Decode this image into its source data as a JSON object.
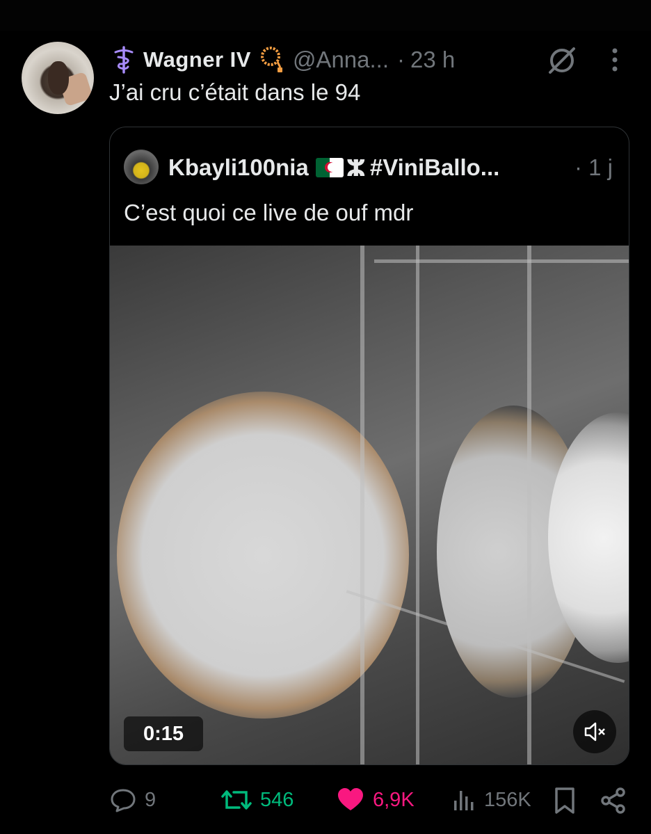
{
  "tweet": {
    "author_name": "Wagner IV",
    "handle": "@Anna...",
    "separator": "·",
    "time": "23 h",
    "text": "J’ai cru c’était dans le 94"
  },
  "quoted_tweet": {
    "author_name": "Kbayli100nia",
    "yaz_symbol": "ⵣ",
    "hashtag": "#ViniBallo...",
    "time": "· 1 j",
    "text": "C’est quoi ce live de ouf mdr",
    "video_duration": "0:15"
  },
  "actions": {
    "replies": "9",
    "reposts": "546",
    "likes": "6,9K",
    "views": "156K"
  },
  "colors": {
    "background": "#000000",
    "text": "#e7e9ea",
    "muted": "#71767b",
    "repost_active": "#00ba7c",
    "like_active": "#f91880",
    "badge_purple": "#a78bfa",
    "beads_orange": "#f59e42"
  },
  "icons": [
    "medical-symbol-icon",
    "prayer-beads-icon",
    "grok-icon",
    "more-icon",
    "mute-icon",
    "reply-icon",
    "repost-icon",
    "like-icon",
    "views-icon",
    "bookmark-icon",
    "share-icon"
  ]
}
